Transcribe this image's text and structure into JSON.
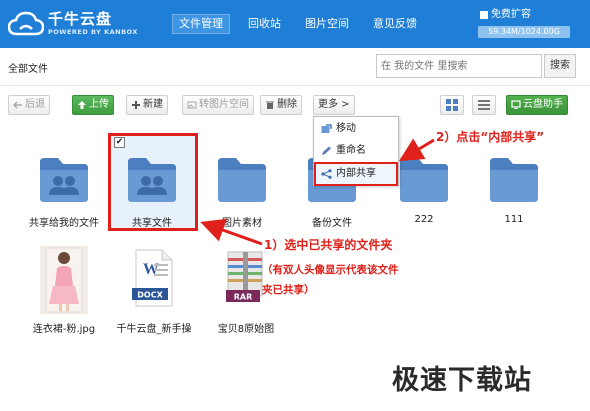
{
  "app": {
    "title": "千牛云盘",
    "subtitle": "POWERED BY KANBOX"
  },
  "nav": [
    {
      "label": "文件管理",
      "active": true
    },
    {
      "label": "回收站"
    },
    {
      "label": "图片空间"
    },
    {
      "label": "意见反馈"
    }
  ],
  "quota": {
    "expand_label": "免费扩容",
    "usage_text": "59.34M/1024.00G",
    "used_fraction": 0.0001
  },
  "breadcrumb": "全部文件",
  "search": {
    "placeholder": "在 我的文件 里搜索",
    "button_label": "搜索"
  },
  "toolbar": {
    "back": "后退",
    "upload": "上传",
    "new": "新建",
    "to_image_space": "转图片空间",
    "delete": "删除",
    "more": "更多 >",
    "assistant": "云盘助手"
  },
  "more_menu": [
    {
      "label": "移动",
      "icon": "move-icon"
    },
    {
      "label": "重命名",
      "icon": "pencil-icon"
    },
    {
      "label": "内部共享",
      "icon": "share-icon"
    }
  ],
  "files": [
    {
      "name": "共享给我的文件",
      "type": "shared-folder"
    },
    {
      "name": "共享文件",
      "type": "shared-folder",
      "selected": true
    },
    {
      "name": "图片素材",
      "type": "folder"
    },
    {
      "name": "备份文件",
      "type": "folder"
    },
    {
      "name": "222",
      "type": "folder"
    },
    {
      "name": "111",
      "type": "folder"
    },
    {
      "name": "连衣裙-粉.jpg",
      "type": "image"
    },
    {
      "name": "千牛云盘_新手操",
      "type": "docx",
      "badge": "DOCX"
    },
    {
      "name": "宝贝8原始图",
      "type": "rar",
      "badge": "RAR"
    }
  ],
  "annotations": {
    "step1_line1": "1）选中已共享的文件夹",
    "step1_line2": "（有双人头像显示代表该文件",
    "step1_line3": "夹已共享）",
    "step2": "2）点击“内部共享”"
  },
  "watermark": "极速下载站",
  "colors": {
    "header": "#1f7fd6",
    "folder": "#5b8fcf",
    "annotation": "#e0201b",
    "green": "#4aa84a"
  }
}
